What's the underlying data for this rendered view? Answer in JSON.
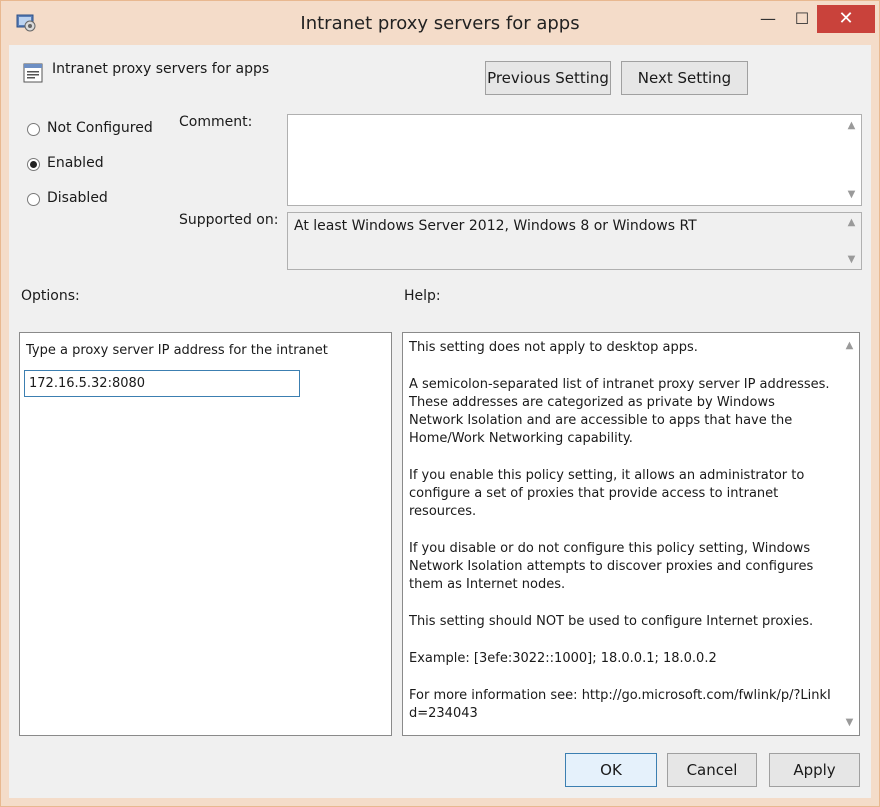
{
  "window": {
    "title": "Intranet proxy servers for  apps",
    "controls": {
      "minimize": "—",
      "maximize": "☐",
      "close": "✕"
    }
  },
  "header": {
    "policy_name": "Intranet proxy servers for  apps",
    "previous_label": "Previous Setting",
    "next_label": "Next Setting"
  },
  "state": {
    "options": [
      {
        "label": "Not Configured",
        "selected": false
      },
      {
        "label": "Enabled",
        "selected": true
      },
      {
        "label": "Disabled",
        "selected": false
      }
    ]
  },
  "comment": {
    "label": "Comment:",
    "value": ""
  },
  "supported": {
    "label": "Supported on:",
    "value": "At least Windows Server 2012, Windows 8 or Windows RT"
  },
  "options_panel": {
    "heading": "Options:",
    "field_label": "Type a proxy server IP address for the intranet",
    "field_value": "172.16.5.32:8080"
  },
  "help_panel": {
    "heading": "Help:",
    "paragraphs": [
      "This setting does not apply to desktop apps.",
      "A  semicolon-separated list of intranet proxy server IP addresses. These addresses are categorized as private by Windows Network Isolation and are accessible to  apps that have the Home/Work Networking capability.",
      "If you enable this policy setting, it allows an administrator to configure a set of proxies that provide access to intranet resources.",
      "If you disable or do not configure this policy setting, Windows Network Isolation attempts to discover proxies and configures them as Internet nodes.",
      "This setting should NOT be used to configure Internet proxies.",
      "Example: [3efe:3022::1000]; 18.0.0.1; 18.0.0.2",
      "For more information see: http://go.microsoft.com/fwlink/p/?LinkId=234043"
    ]
  },
  "footer": {
    "ok": "OK",
    "cancel": "Cancel",
    "apply": "Apply"
  },
  "colors": {
    "frame": "#f4dcc9",
    "close": "#c9423b",
    "focus": "#3c7fb1"
  }
}
